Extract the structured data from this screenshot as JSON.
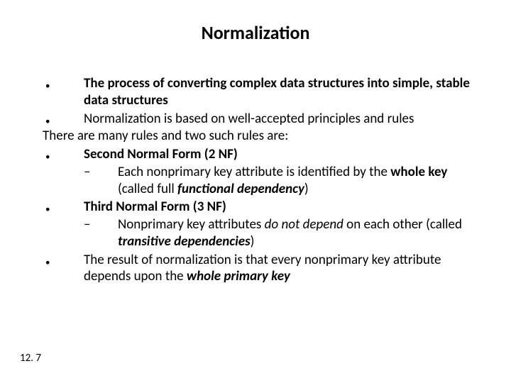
{
  "title": "Normalization",
  "b1_a": "The process of converting complex data structures into simple, stable data structures",
  "b2": "Normalization is based on well-accepted principles and rules",
  "plain": "There are many rules and two such rules are:",
  "b3_a": "Second Normal Form (2 NF)",
  "s3_pre": "Each nonprimary key attribute is identified by the ",
  "s3_bold": "whole key",
  "s3_mid": " (called full ",
  "s3_bi": "functional dependency",
  "s3_post": ")",
  "b4_a": "Third Normal Form (3 NF)",
  "s4_pre": "Nonprimary key attributes ",
  "s4_i1": "do not depend",
  "s4_mid": " on each other (called ",
  "s4_bi": "transitive dependencies",
  "s4_post": ")",
  "b5_pre": "The result of normalization is that every nonprimary key attribute depends upon the ",
  "b5_bi": "whole primary key",
  "footer": "12. 7"
}
